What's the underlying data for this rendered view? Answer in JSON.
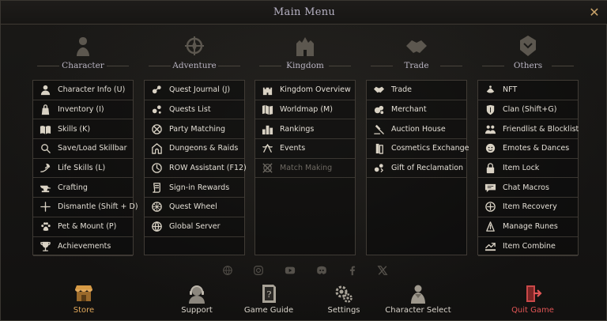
{
  "window": {
    "title": "Main Menu",
    "close_icon": "close-x-icon"
  },
  "columns": [
    {
      "title": "Character",
      "emblem": "character-emblem-icon",
      "items": [
        {
          "label": "Character Info (U)",
          "icon": "bust-icon"
        },
        {
          "label": "Inventory (I)",
          "icon": "bag-icon"
        },
        {
          "label": "Skills (K)",
          "icon": "book-icon"
        },
        {
          "label": "Save/Load Skillbar",
          "icon": "magnifier-icon"
        },
        {
          "label": "Life Skills (L)",
          "icon": "hand-leaf-icon"
        },
        {
          "label": "Crafting",
          "icon": "anvil-icon"
        },
        {
          "label": "Dismantle (Shift + D)",
          "icon": "dismantle-icon"
        },
        {
          "label": "Pet & Mount (P)",
          "icon": "paw-icon"
        },
        {
          "label": "Achievements",
          "icon": "trophy-icon"
        }
      ]
    },
    {
      "title": "Adventure",
      "emblem": "adventure-emblem-icon",
      "items": [
        {
          "label": "Quest Journal (J)",
          "icon": "quest-icon"
        },
        {
          "label": "Quests List",
          "icon": "quest-list-icon"
        },
        {
          "label": "Party Matching",
          "icon": "party-icon"
        },
        {
          "label": "Dungeons & Raids",
          "icon": "dungeon-icon"
        },
        {
          "label": "ROW Assistant (F12)",
          "icon": "clock-icon"
        },
        {
          "label": "Sign-in Rewards",
          "icon": "scroll-icon"
        },
        {
          "label": "Quest Wheel",
          "icon": "wheel-icon"
        },
        {
          "label": "Global Server",
          "icon": "globe-icon"
        }
      ]
    },
    {
      "title": "Kingdom",
      "emblem": "kingdom-emblem-icon",
      "items": [
        {
          "label": "Kingdom Overview",
          "icon": "castle-icon"
        },
        {
          "label": "Worldmap (M)",
          "icon": "map-icon"
        },
        {
          "label": "Rankings",
          "icon": "rankings-icon"
        },
        {
          "label": "Events",
          "icon": "events-icon"
        },
        {
          "label": "Match Making",
          "icon": "match-icon",
          "disabled": true
        }
      ]
    },
    {
      "title": "Trade",
      "emblem": "trade-emblem-icon",
      "items": [
        {
          "label": "Trade",
          "icon": "handshake-icon"
        },
        {
          "label": "Merchant",
          "icon": "merchant-icon"
        },
        {
          "label": "Auction House",
          "icon": "gavel-icon"
        },
        {
          "label": "Cosmetics Exchange",
          "icon": "cosmetics-icon"
        },
        {
          "label": "Gift of Reclamation",
          "icon": "gift-icon"
        }
      ]
    },
    {
      "title": "Others",
      "emblem": "others-emblem-icon",
      "items": [
        {
          "label": "NFT",
          "icon": "nft-icon"
        },
        {
          "label": "Clan (Shift+G)",
          "icon": "clan-icon"
        },
        {
          "label": "Friendlist & Blocklist",
          "icon": "friends-icon"
        },
        {
          "label": "Emotes & Dances",
          "icon": "emote-icon"
        },
        {
          "label": "Item Lock",
          "icon": "lock-icon"
        },
        {
          "label": "Chat Macros",
          "icon": "chat-icon"
        },
        {
          "label": "Item Recovery",
          "icon": "recovery-icon"
        },
        {
          "label": "Manage Runes",
          "icon": "runes-icon"
        },
        {
          "label": "Item Combine",
          "icon": "combine-icon"
        }
      ]
    }
  ],
  "socials": [
    "website-icon",
    "instagram-icon",
    "youtube-icon",
    "discord-icon",
    "facebook-icon",
    "x-icon"
  ],
  "bottom_bar": [
    {
      "label": "Store",
      "icon": "store-icon",
      "kind": "store"
    },
    {
      "label": "Support",
      "icon": "support-icon",
      "kind": "normal"
    },
    {
      "label": "Game Guide",
      "icon": "guide-icon",
      "kind": "normal"
    },
    {
      "label": "Settings",
      "icon": "gears-icon",
      "kind": "normal"
    },
    {
      "label": "Character Select",
      "icon": "character-select-icon",
      "kind": "normal"
    },
    {
      "label": "Quit Game",
      "icon": "exit-door-icon",
      "kind": "quit"
    }
  ],
  "colors": {
    "accent_gold": "#e0a85b",
    "quit_red": "#e05555",
    "title": "#b7b2c4",
    "text": "#e3ded5",
    "disabled": "#6d6962"
  }
}
